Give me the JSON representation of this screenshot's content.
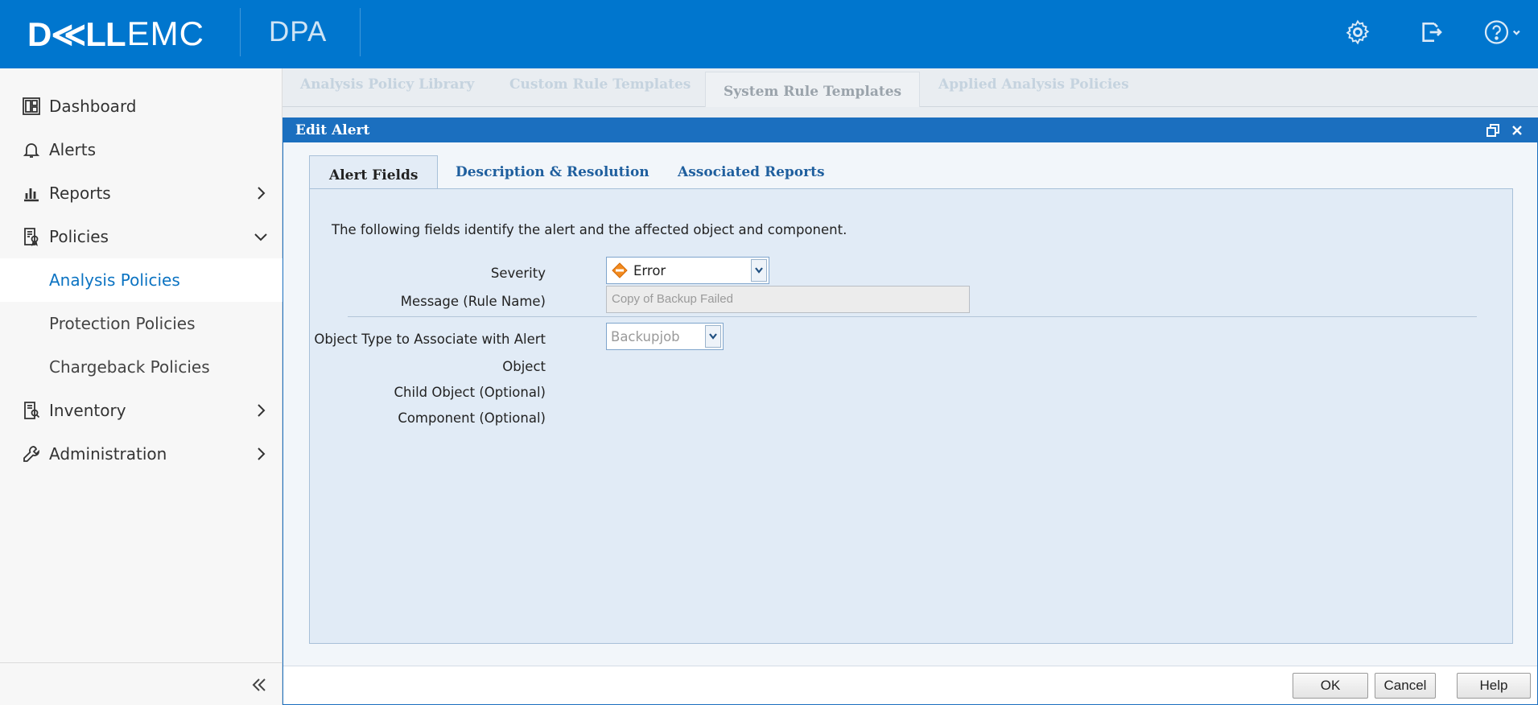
{
  "header": {
    "brand_dell": "D≪LL",
    "brand_emc": "EMC",
    "product": "DPA",
    "icons": [
      "gear-icon",
      "logout-icon",
      "help-icon"
    ]
  },
  "sidebar": {
    "items": [
      {
        "label": "Dashboard",
        "icon": "dashboard-icon"
      },
      {
        "label": "Alerts",
        "icon": "bell-icon"
      },
      {
        "label": "Reports",
        "icon": "bar-chart-icon"
      },
      {
        "label": "Policies",
        "icon": "policy-icon"
      },
      {
        "label": "Inventory",
        "icon": "inventory-icon"
      },
      {
        "label": "Administration",
        "icon": "wrench-icon"
      }
    ],
    "policies_sub": [
      "Analysis Policies",
      "Protection Policies",
      "Chargeback Policies"
    ],
    "active_sub": "Analysis Policies"
  },
  "bg_tabs": [
    "Analysis Policy Library",
    "Custom Rule Templates",
    "System Rule Templates",
    "Applied Analysis Policies"
  ],
  "dialog": {
    "title": "Edit Alert",
    "tabs": [
      "Alert Fields",
      "Description & Resolution",
      "Associated Reports"
    ],
    "intro": "The following fields identify the alert and the affected object and component.",
    "labels": {
      "severity": "Severity",
      "message": "Message (Rule Name)",
      "object_type": "Object Type to Associate with Alert",
      "object": "Object",
      "child_object": "Child Object (Optional)",
      "component": "Component (Optional)"
    },
    "severity_value": "Error",
    "message_value": "Copy of Backup Failed",
    "object_type_value": "Backupjob",
    "buttons": {
      "ok": "OK",
      "cancel": "Cancel",
      "help": "Help"
    }
  },
  "colors": {
    "brand_blue": "#0076ce",
    "dialog_title": "#1b6fbf",
    "active_link": "#0b73c2",
    "error_orange": "#f28a1f"
  }
}
